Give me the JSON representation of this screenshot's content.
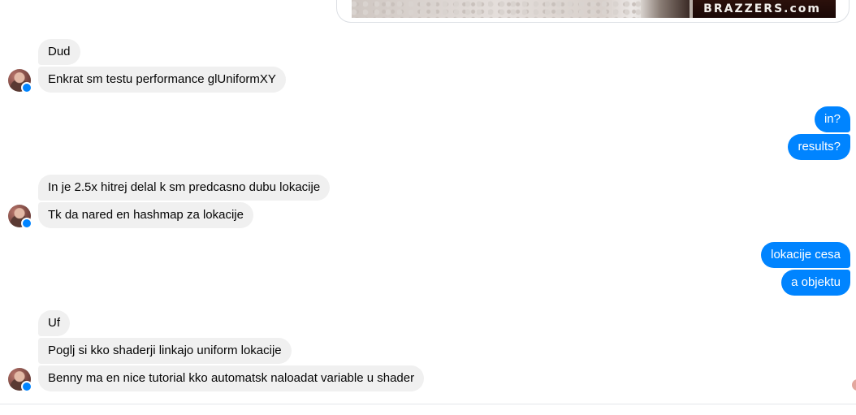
{
  "media": {
    "logo_text": "BRAZZERS.com"
  },
  "conversation": {
    "groups": [
      {
        "direction": "in",
        "messages": [
          "Dud",
          "Enkrat sm testu performance glUniformXY"
        ]
      },
      {
        "direction": "out",
        "messages": [
          "in?",
          "results?"
        ]
      },
      {
        "direction": "in",
        "messages": [
          "In je 2.5x hitrej delal k sm predcasno dubu lokacije",
          "Tk da nared en hashmap za lokacije"
        ]
      },
      {
        "direction": "out",
        "messages": [
          "lokacije cesa",
          "a objektu"
        ]
      },
      {
        "direction": "in",
        "messages": [
          "Uf",
          "Poglj si kko shaderji linkajo uniform lokacije",
          "Benny ma en nice tutorial kko automatsk naloadat variable u shader"
        ]
      }
    ]
  },
  "colors": {
    "incoming_bubble": "#f0f0f0",
    "outgoing_bubble": "#0084ff",
    "messenger_badge": "#0084ff"
  },
  "icons": {
    "avatar": "contact-avatar",
    "badge": "messenger-badge-icon"
  }
}
